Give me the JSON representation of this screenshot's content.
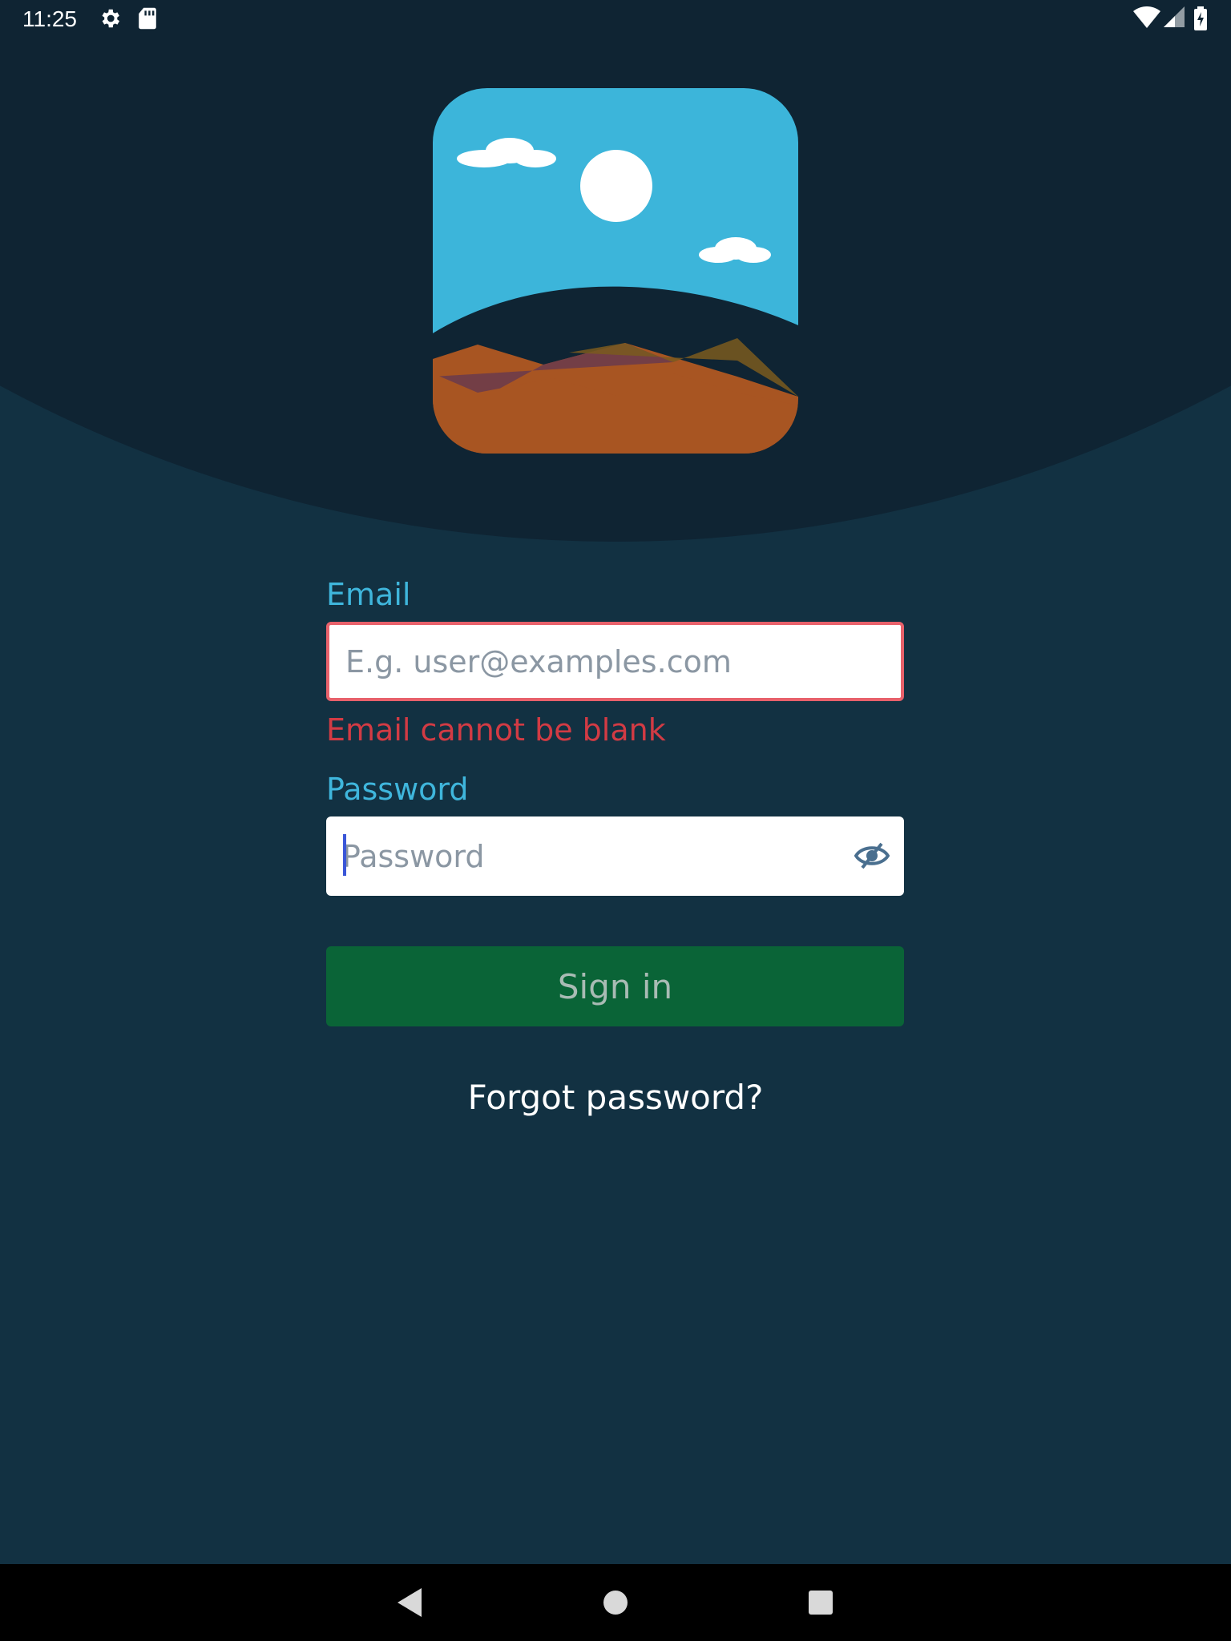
{
  "status_bar": {
    "time": "11:25",
    "icons": [
      "settings-icon",
      "sd-card-icon",
      "wifi-icon",
      "signal-icon",
      "battery-charging-icon"
    ]
  },
  "logo": {
    "icon": "landscape-logo-icon",
    "colors": {
      "sky": "#3cb5da",
      "sun": "#ffffff",
      "ground": "#a85522",
      "hills": "#6d3c4a"
    }
  },
  "form": {
    "email": {
      "label": "Email",
      "value": "",
      "placeholder": "E.g. user@examples.com",
      "error": "Email cannot be blank"
    },
    "password": {
      "label": "Password",
      "value": "",
      "placeholder": "Password",
      "toggle_icon": "visibility-toggle-icon"
    },
    "signin_label": "Sign in",
    "forgot_label": "Forgot password?"
  },
  "colors": {
    "background": "#123142",
    "header": "#0f2433",
    "label": "#3fb6dc",
    "error": "#d23b44",
    "button": "#0a6437"
  },
  "nav_bar": {
    "buttons": [
      "back-icon",
      "home-icon",
      "recents-icon"
    ]
  }
}
